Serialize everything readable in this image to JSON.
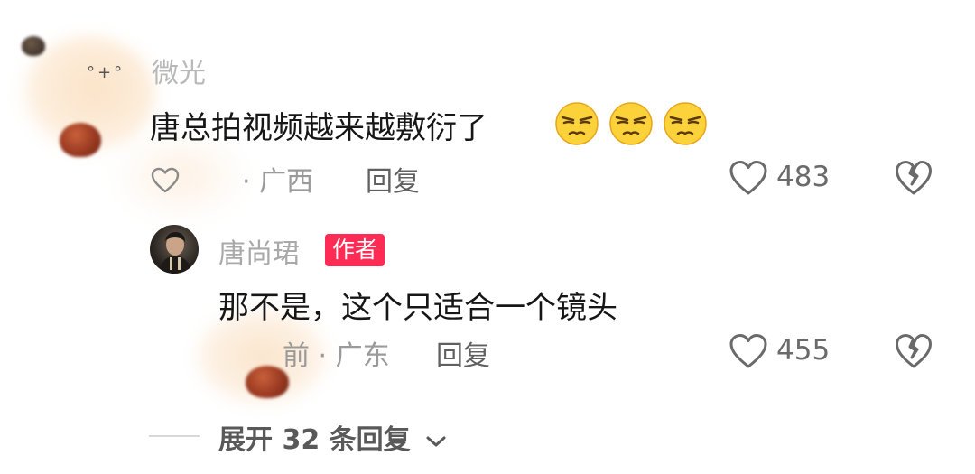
{
  "comments": [
    {
      "username": "微光",
      "text": "唐总拍视频越来越敷衍了",
      "emoji": [
        "disdain-face-emoji",
        "disdain-face-emoji",
        "disdain-face-emoji"
      ],
      "location": "· 广西",
      "reply_label": "回复",
      "likes": "483"
    }
  ],
  "reply": {
    "username": "唐尚珺",
    "badge": "作者",
    "text": "那不是，这个只适合一个镜头",
    "location": "前 · 广东",
    "reply_label": "回复",
    "likes": "455"
  },
  "expand_label": "展开 32 条回复",
  "sparkle_text": "°+°",
  "icons": {
    "small_like": "small-heart-icon",
    "like": "heart-icon",
    "dislike": "broken-heart-icon",
    "expand": "chevron-down-icon"
  },
  "colors": {
    "badge": "#fe2c55",
    "text": "#161616",
    "meta": "#9a9a9a"
  }
}
